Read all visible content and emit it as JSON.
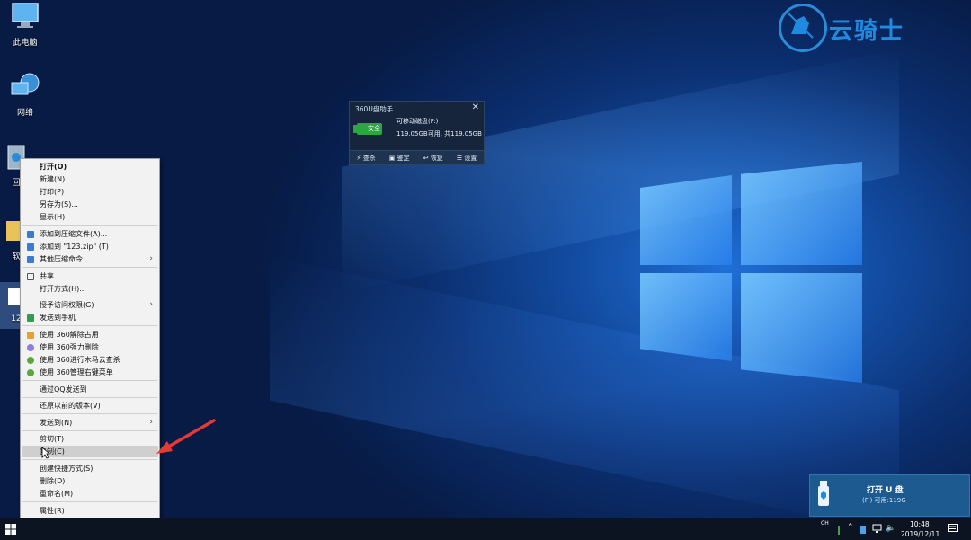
{
  "desktop": {
    "icons": [
      {
        "label": "此电脑"
      },
      {
        "label": "网络"
      },
      {
        "label": "回"
      },
      {
        "label": "软"
      },
      {
        "label": "12"
      }
    ]
  },
  "logo": {
    "text": "云骑士"
  },
  "widget": {
    "title": "360U盘助手",
    "close": "✕",
    "badge": "安全",
    "drive_name": "可移动磁盘(F:)",
    "capacity": "119.05GB可用, 共119.05GB",
    "actions": [
      {
        "label": "查杀"
      },
      {
        "label": "鉴定"
      },
      {
        "label": "恢复"
      },
      {
        "label": "设置"
      }
    ]
  },
  "context_menu": {
    "items": [
      {
        "label": "打开(O)"
      },
      {
        "label": "新建(N)"
      },
      {
        "label": "打印(P)"
      },
      {
        "label": "另存为(S)..."
      },
      {
        "label": "显示(H)"
      },
      {
        "label": "添加到压缩文件(A)..."
      },
      {
        "label": "添加到 \"123.zip\" (T)"
      },
      {
        "label": "其他压缩命令"
      },
      {
        "label": "共享"
      },
      {
        "label": "打开方式(H)..."
      },
      {
        "label": "授予访问权限(G)"
      },
      {
        "label": "发送到手机"
      },
      {
        "label": "使用 360解除占用"
      },
      {
        "label": "使用 360强力删除"
      },
      {
        "label": "使用 360进行木马云查杀"
      },
      {
        "label": "使用 360管理右键菜单"
      },
      {
        "label": "通过QQ发送到"
      },
      {
        "label": "还原以前的版本(V)"
      },
      {
        "label": "发送到(N)"
      },
      {
        "label": "剪切(T)"
      },
      {
        "label": "复制(C)"
      },
      {
        "label": "创建快捷方式(S)"
      },
      {
        "label": "删除(D)"
      },
      {
        "label": "重命名(M)"
      },
      {
        "label": "属性(R)"
      }
    ]
  },
  "usb_notification": {
    "title": "打开 U 盘",
    "info": "(F:)  可用:119G"
  },
  "taskbar": {
    "ime_top": "CH",
    "ime_bottom": "",
    "time": "10:48",
    "date": "2019/12/11"
  },
  "colors": {
    "accent": "#1f8ae0",
    "arrow": "#e53935",
    "safe": "#2aa840"
  }
}
